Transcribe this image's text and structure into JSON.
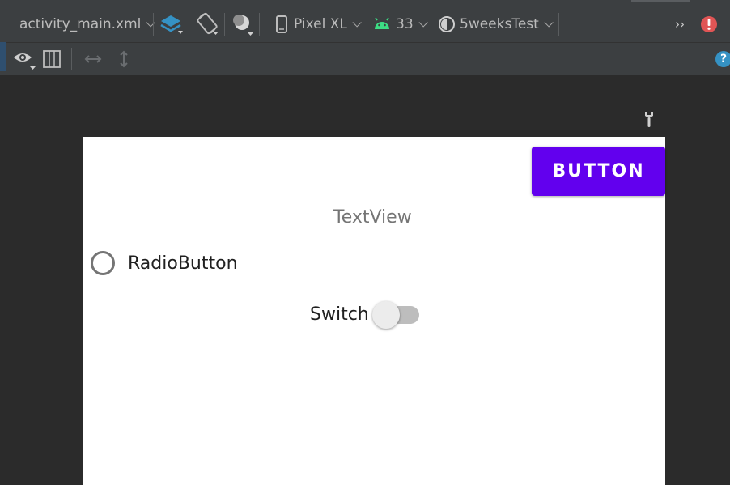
{
  "toolbar": {
    "file_name": "activity_main.xml",
    "device": "Pixel XL",
    "api_level": "33",
    "theme": "5weeksTest",
    "overflow": "››"
  },
  "toolbar2": {
    "help_symbol": "?"
  },
  "preview": {
    "button_label": "BUTTON",
    "textview_text": "TextView",
    "radio_label": "RadioButton",
    "switch_label": "Switch"
  },
  "colors": {
    "ide_background": "#2b2b2b",
    "toolbar_background": "#3c3f41",
    "button_purple": "#6200ee",
    "android_green": "#3ddc84",
    "error_red": "#e05555",
    "help_blue": "#3592c4"
  },
  "icons": [
    "layers-icon",
    "orientation-icon",
    "night-mode-icon",
    "phone-icon",
    "android-icon",
    "theme-icon",
    "error-icon",
    "eye-icon",
    "blueprint-icon",
    "horizontal-resize-icon",
    "vertical-resize-icon",
    "help-icon",
    "wrench-icon"
  ]
}
